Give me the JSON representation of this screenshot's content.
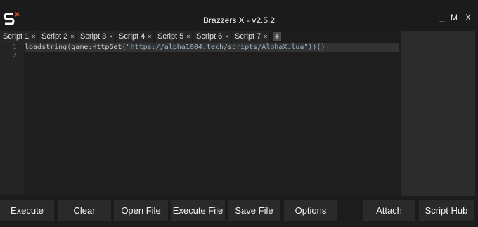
{
  "window": {
    "title": "Brazzers X - v2.5.2",
    "minimize_label": "_",
    "maximize_label": "M",
    "close_label": "X"
  },
  "tabs": [
    {
      "label": "Script 1",
      "close": "×"
    },
    {
      "label": "Script 2",
      "close": "×"
    },
    {
      "label": "Script 3",
      "close": "×"
    },
    {
      "label": "Script 4",
      "close": "×"
    },
    {
      "label": "Script 5",
      "close": "×"
    },
    {
      "label": "Script 6",
      "close": "×"
    },
    {
      "label": "Script 7",
      "close": "×"
    }
  ],
  "add_tab_label": "+",
  "editor": {
    "line_numbers": [
      "1",
      "2"
    ],
    "code": {
      "fn": "loadstring",
      "open1": "(",
      "obj": "game:HttpGet",
      "open2": "(",
      "str": "\"https://alpha1004.tech/scripts/AlphaX.lua\"",
      "close": "))()"
    }
  },
  "buttons": {
    "execute": "Execute",
    "clear": "Clear",
    "open_file": "Open File",
    "execute_file": "Execute File",
    "save_file": "Save File",
    "options": "Options",
    "attach": "Attach",
    "script_hub": "Script Hub"
  },
  "colors": {
    "logo_accent": "#e0531f",
    "background": "#1c1c1c",
    "button": "#2a2a2a"
  }
}
